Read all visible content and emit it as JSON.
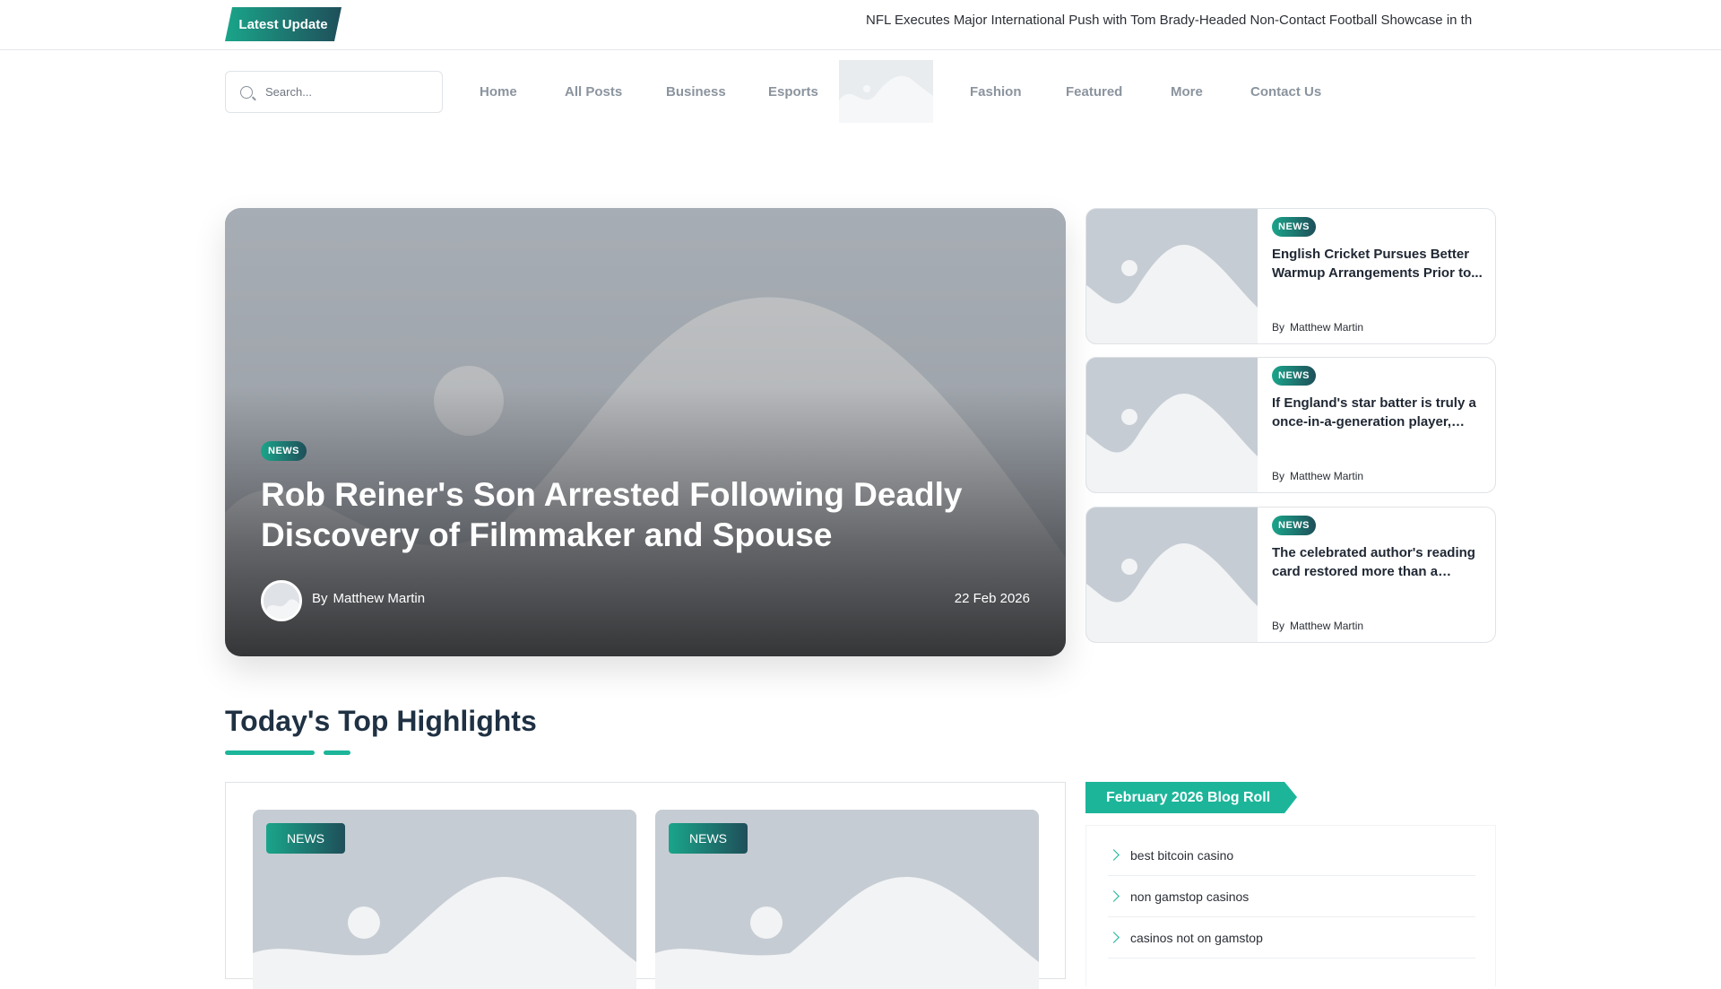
{
  "topbar": {
    "latest_label": "Latest Update",
    "ticker_text": "NFL Executes Major International Push with Tom Brady-Headed Non-Contact Football Showcase in th"
  },
  "search": {
    "placeholder": "Search..."
  },
  "nav": {
    "items": [
      "Home",
      "All Posts",
      "Business",
      "Esports",
      "Fashion",
      "Featured",
      "More",
      "Contact Us"
    ]
  },
  "hero": {
    "tag": "NEWS",
    "title": "Rob Reiner's Son Arrested Following Deadly Discovery of Filmmaker and Spouse",
    "by_label": "By",
    "author": "Matthew Martin",
    "date": "22 Feb 2026"
  },
  "side_cards": [
    {
      "tag": "NEWS",
      "title": "English Cricket Pursues Better Warmup Arrangements Prior to...",
      "by_label": "By",
      "author": "Matthew Martin"
    },
    {
      "tag": "NEWS",
      "title": "If England's star batter is truly a once-in-a-generation player, that...",
      "by_label": "By",
      "author": "Matthew Martin"
    },
    {
      "tag": "NEWS",
      "title": "The celebrated author's reading card restored more than a centur...",
      "by_label": "By",
      "author": "Matthew Martin"
    }
  ],
  "highlights": {
    "title": "Today's Top Highlights",
    "cards": [
      {
        "tag": "NEWS"
      },
      {
        "tag": "NEWS"
      }
    ]
  },
  "blog_roll": {
    "title": "February 2026 Blog Roll",
    "items": [
      "best bitcoin casino",
      "non gamstop casinos",
      "casinos not on gamstop"
    ]
  },
  "colors": {
    "accent": "#1cb59a",
    "accent_dark": "#1f4f5a",
    "heading": "#1f3143",
    "nav_text": "#8b949e",
    "placeholder_bg": "#c6ccd3"
  }
}
